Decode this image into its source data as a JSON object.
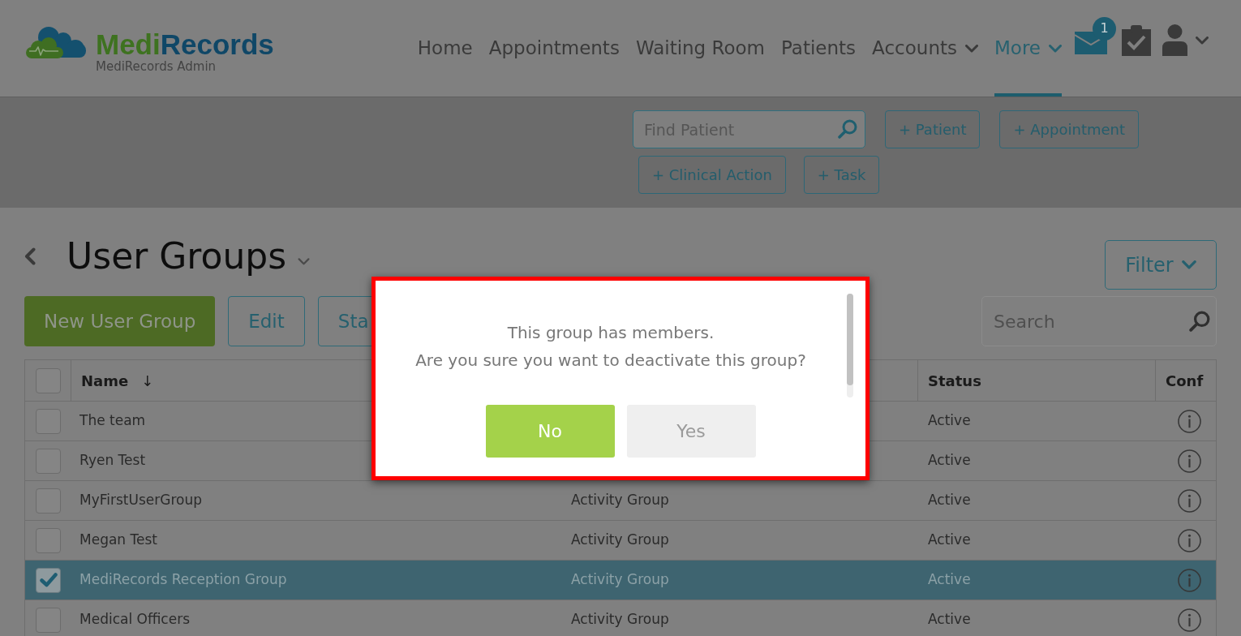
{
  "header": {
    "logo": {
      "brand_part_1": "Medi",
      "brand_part_2": "Records",
      "subtitle": "MediRecords Admin"
    },
    "nav": [
      {
        "label": "Home",
        "selected": false,
        "has_menu": false
      },
      {
        "label": "Appointments",
        "selected": false,
        "has_menu": false
      },
      {
        "label": "Waiting Room",
        "selected": false,
        "has_menu": false
      },
      {
        "label": "Patients",
        "selected": false,
        "has_menu": false
      },
      {
        "label": "Accounts",
        "selected": false,
        "has_menu": true
      },
      {
        "label": "More",
        "selected": true,
        "has_menu": true
      }
    ],
    "messages_badge": "1"
  },
  "quick_actions": {
    "find_patient": {
      "placeholder": "Find Patient"
    },
    "buttons": [
      "+ Patient",
      "+ Appointment",
      "+ Clinical Action",
      "+ Task"
    ]
  },
  "page": {
    "title": "User Groups",
    "filter_button": "Filter",
    "actions": [
      {
        "label": "New User Group",
        "kind": "primary"
      },
      {
        "label": "Edit",
        "kind": "outline"
      },
      {
        "label": "Sta",
        "kind": "outline"
      }
    ],
    "search": {
      "placeholder": "Search"
    }
  },
  "table": {
    "select_all": {
      "checked": false
    },
    "columns": {
      "name": {
        "label": "Name",
        "sort_indicator": "↓"
      },
      "status": {
        "label": "Status"
      },
      "conf": {
        "label": "Conf"
      }
    },
    "rows": [
      {
        "name": "The team",
        "status": "Active",
        "checked": false,
        "selected": false
      },
      {
        "name": "Ryen Test",
        "status": "Active",
        "checked": false,
        "selected": false
      },
      {
        "name": "MyFirstUserGroup",
        "column_3": "Activity Group",
        "status": "Active",
        "checked": false,
        "selected": false
      },
      {
        "name": "Megan Test",
        "column_3": "Activity Group",
        "status": "Active",
        "checked": false,
        "selected": false
      },
      {
        "name": "MediRecords Reception Group",
        "column_3": "Activity Group",
        "status": "Active",
        "checked": true,
        "selected": true
      },
      {
        "name": "Medical Officers",
        "column_3": "Activity Group",
        "status": "Active",
        "checked": false,
        "selected": false
      }
    ]
  },
  "dialog": {
    "message_lines": [
      "This group has members.",
      "Are you sure you want to deactivate this group?"
    ],
    "buttons": [
      {
        "label": "No",
        "kind": "primary"
      },
      {
        "label": "Yes",
        "kind": "secondary"
      }
    ]
  }
}
